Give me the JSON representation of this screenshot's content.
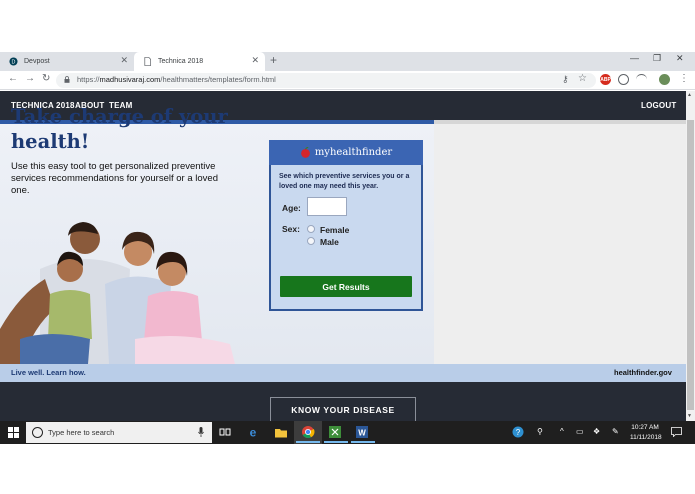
{
  "browser": {
    "tabs": [
      {
        "title": "Devpost",
        "active": false
      },
      {
        "title": "Technica 2018",
        "active": true
      }
    ],
    "new_tab": "+",
    "window_controls": {
      "minimize": "—",
      "restore": "❐",
      "close": "✕"
    },
    "nav": {
      "back": "←",
      "forward": "→",
      "reload": "↻"
    },
    "url_prefix": "https://",
    "url_host": "madhusivaraj.com",
    "url_path": "/healthmatters/templates/form.html",
    "extensions": {
      "abp": "ABP",
      "star": "☆",
      "key": "⚷"
    }
  },
  "site": {
    "brand": "TECHNICA 2018",
    "nav_links": [
      "ABOUT",
      "TEAM"
    ],
    "logout": "LOGOUT"
  },
  "hero": {
    "title": "Take charge of your health!",
    "subtitle": "Use this easy tool to get personalized preventive services recommendations for yourself or a loved one."
  },
  "widget": {
    "brand": "myhealthfinder",
    "description": "See which preventive services you or a loved one may need this year.",
    "age_label": "Age:",
    "age_value": "",
    "sex_label": "Sex:",
    "sex_options": [
      "Female",
      "Male"
    ],
    "submit_label": "Get Results"
  },
  "tagline": "Live well. Learn how.",
  "healthfinder_logo": "healthfinder.gov",
  "know_button": "KNOW YOUR DISEASE",
  "taskbar": {
    "search_placeholder": "Type here to search",
    "time": "10:27 AM",
    "date": "11/11/2018"
  },
  "colors": {
    "navbar": "#262b35",
    "hero_title": "#1d3a74",
    "widget_header": "#3b65b3",
    "widget_body": "#c9d9ef",
    "submit_button": "#17761c",
    "tagline_bar": "#b9cde8"
  }
}
